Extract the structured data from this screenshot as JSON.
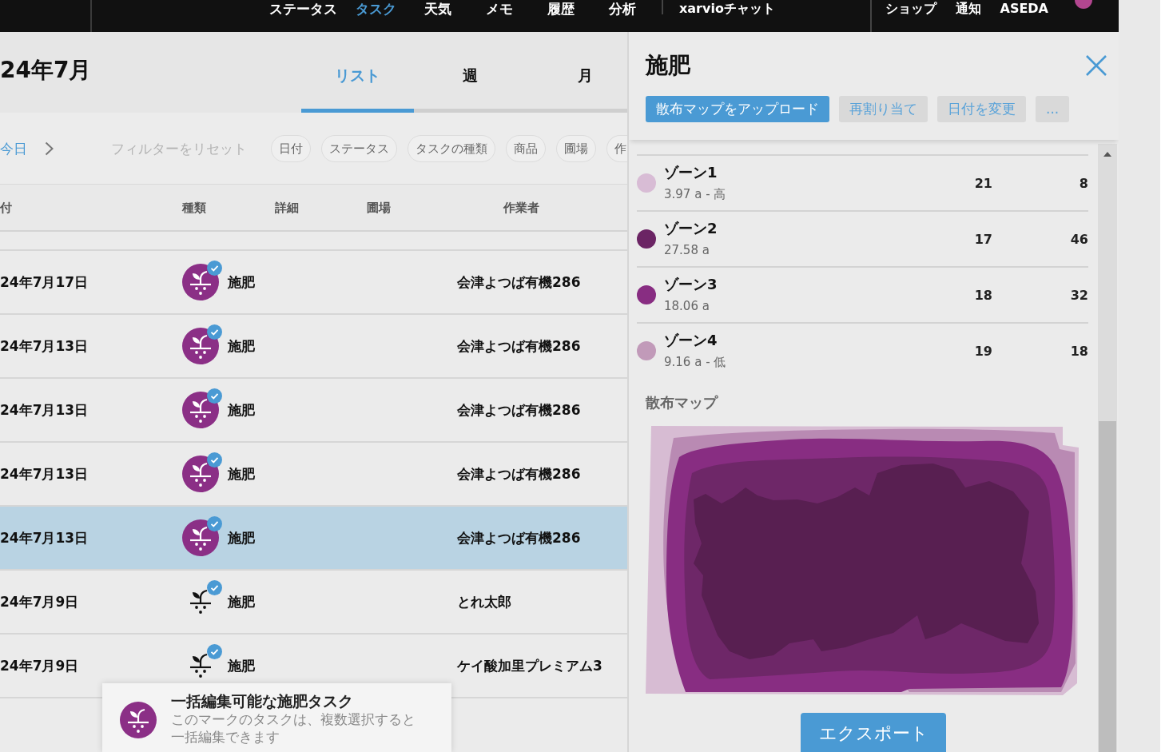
{
  "top_nav": {
    "tabs": [
      {
        "label": "ステータス",
        "selected": false
      },
      {
        "label": "タスク",
        "selected": true
      },
      {
        "label": "天気",
        "selected": false
      },
      {
        "label": "メモ",
        "selected": false
      },
      {
        "label": "履歴",
        "selected": false
      },
      {
        "label": "分析",
        "selected": false
      }
    ],
    "chat_link": "xarvioチャット",
    "links": [
      "ショップ",
      "通知",
      "ASEDA"
    ]
  },
  "task_list": {
    "title": "24年7月",
    "view_tabs": [
      {
        "label": "リスト",
        "selected": true
      },
      {
        "label": "週",
        "selected": false
      },
      {
        "label": "月",
        "selected": false
      }
    ],
    "filters": {
      "today": "今日",
      "reset": "フィルターをリセット",
      "chips": [
        "日付",
        "ステータス",
        "タスクの種類",
        "商品",
        "圃場",
        "作"
      ]
    },
    "columns": [
      "付",
      "種類",
      "詳細",
      "圃場",
      "作業者"
    ],
    "rows": [
      {
        "date": "24年7月17日",
        "type": "施肥",
        "worker": "会津よつば有機286",
        "bulk_editable": true,
        "done": true,
        "selected": false
      },
      {
        "date": "24年7月13日",
        "type": "施肥",
        "worker": "会津よつば有機286",
        "bulk_editable": true,
        "done": true,
        "selected": false
      },
      {
        "date": "24年7月13日",
        "type": "施肥",
        "worker": "会津よつば有機286",
        "bulk_editable": true,
        "done": true,
        "selected": false
      },
      {
        "date": "24年7月13日",
        "type": "施肥",
        "worker": "会津よつば有機286",
        "bulk_editable": true,
        "done": true,
        "selected": false
      },
      {
        "date": "24年7月13日",
        "type": "施肥",
        "worker": "会津よつば有機286",
        "bulk_editable": true,
        "done": true,
        "selected": true
      },
      {
        "date": "24年7月9日",
        "type": "施肥",
        "worker": "とれ太郎",
        "bulk_editable": false,
        "done": true,
        "selected": false
      },
      {
        "date": "24年7月9日",
        "type": "施肥",
        "worker": "ケイ酸加里プレミアム3",
        "bulk_editable": false,
        "done": true,
        "selected": false
      }
    ]
  },
  "tooltip": {
    "title": "一括編集可能な施肥タスク",
    "text": "このマークのタスクは、複数選択すると一括編集できます"
  },
  "detail_panel": {
    "title": "施肥",
    "actions": [
      {
        "label": "散布マップをアップロード",
        "kind": "primary"
      },
      {
        "label": "再割り当て",
        "kind": "secondary"
      },
      {
        "label": "日付を変更",
        "kind": "secondary"
      },
      {
        "label": "...",
        "kind": "secondary"
      }
    ],
    "zones": [
      {
        "name": "ゾーン1",
        "area": "3.97 a - 高",
        "color": "#d8bcd5",
        "value_1": "21",
        "value_2": "8"
      },
      {
        "name": "ゾーン2",
        "area": "27.58 a",
        "color": "#6b2464",
        "value_1": "17",
        "value_2": "46"
      },
      {
        "name": "ゾーン3",
        "area": "18.06 a",
        "color": "#882d82",
        "value_1": "18",
        "value_2": "32"
      },
      {
        "name": "ゾーン4",
        "area": "9.16 a - 低",
        "color": "#c19ab9",
        "value_1": "19",
        "value_2": "18"
      }
    ],
    "map_title": "散布マップ",
    "export_label": "エクスポート"
  }
}
